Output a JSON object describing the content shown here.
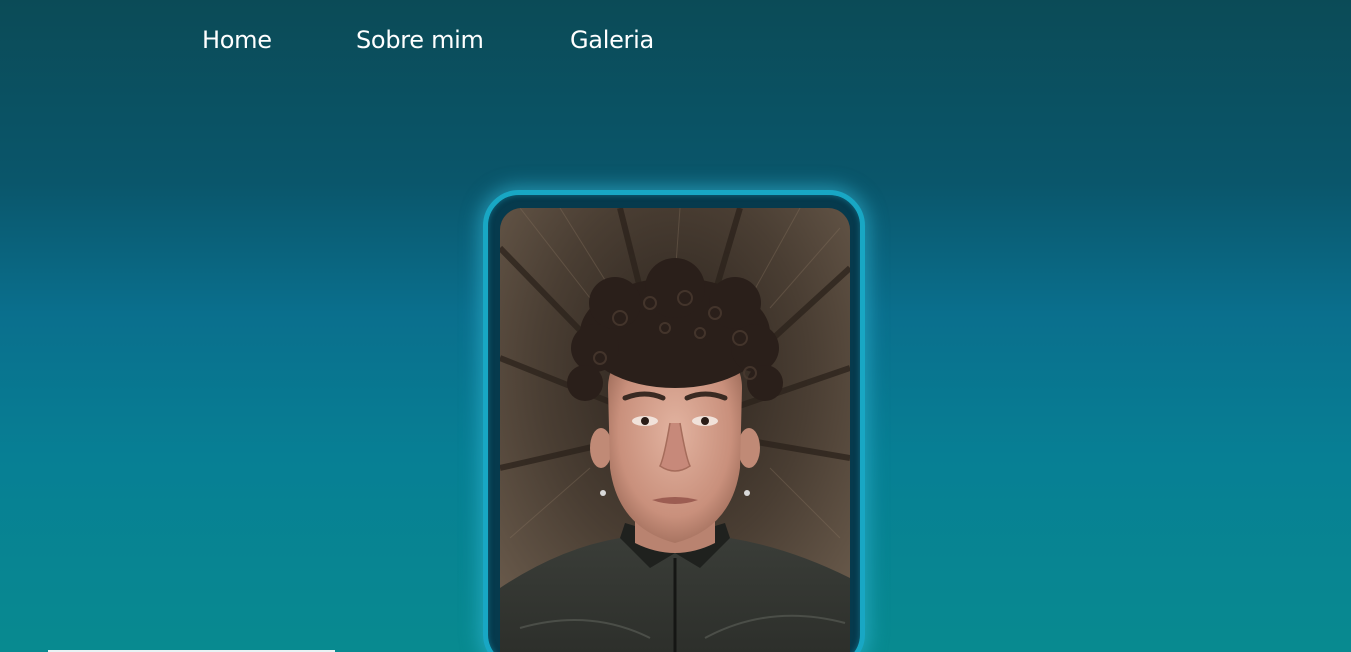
{
  "nav": {
    "items": [
      {
        "label": "Home"
      },
      {
        "label": "Sobre mim"
      },
      {
        "label": "Galeria"
      }
    ]
  },
  "hero": {
    "frame_color": "#18a7c4",
    "photo_icon": "portrait-photo"
  },
  "theme": {
    "background_top": "#0b4b57",
    "background_mid": "#0a6f8d",
    "background_bottom": "#088a90"
  }
}
